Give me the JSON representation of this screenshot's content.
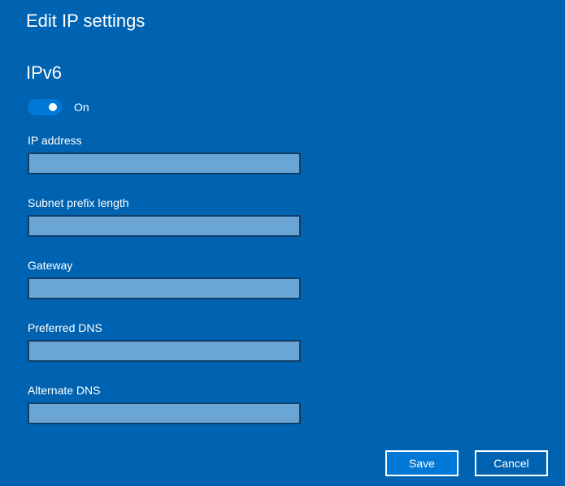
{
  "dialog": {
    "title": "Edit IP settings"
  },
  "section": {
    "title": "IPv6",
    "toggle": {
      "state": "On",
      "enabled": true
    }
  },
  "fields": [
    {
      "label": "IP address",
      "value": ""
    },
    {
      "label": "Subnet prefix length",
      "value": ""
    },
    {
      "label": "Gateway",
      "value": ""
    },
    {
      "label": "Preferred DNS",
      "value": ""
    },
    {
      "label": "Alternate DNS",
      "value": ""
    }
  ],
  "buttons": {
    "save_label": "Save",
    "cancel_label": "Cancel"
  },
  "colors": {
    "background": "#0063b1",
    "accent": "#0078d7",
    "input_fill": "#6aa5d4",
    "input_border": "#0f3f68"
  }
}
